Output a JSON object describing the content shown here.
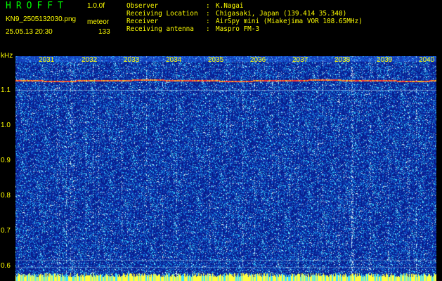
{
  "header": {
    "app_name": "HROFFT",
    "version": "1.0.0f",
    "filename": "KN9_2505132030.png",
    "mode": "meteor",
    "datetime": "25.05.13 20:30",
    "count": "133"
  },
  "info": [
    {
      "key": "Observer",
      "sep": ":",
      "value": "K.Nagai"
    },
    {
      "key": "Receiving Location",
      "sep": ":",
      "value": "Chigasaki, Japan (139.414 35.340)"
    },
    {
      "key": "Receiver",
      "sep": ":",
      "value": "AirSpy mini (Miakejima VOR 108.65MHz)"
    },
    {
      "key": "Receiving antenna",
      "sep": ":",
      "value": "Maspro FM-3"
    }
  ],
  "axes": {
    "y_unit": "kHz",
    "y_ticks": [
      "1.1",
      "1.0",
      "0.9",
      "0.8",
      "0.7",
      "0.6"
    ],
    "x_ticks": [
      "2031",
      "2032",
      "2033",
      "2034",
      "2035",
      "2036",
      "2037",
      "2038",
      "2039",
      "2040"
    ]
  },
  "colors": {
    "label": "#ffff00",
    "title": "#00ff00",
    "background": "#0a1a8a",
    "signal": "#ff3030"
  }
}
